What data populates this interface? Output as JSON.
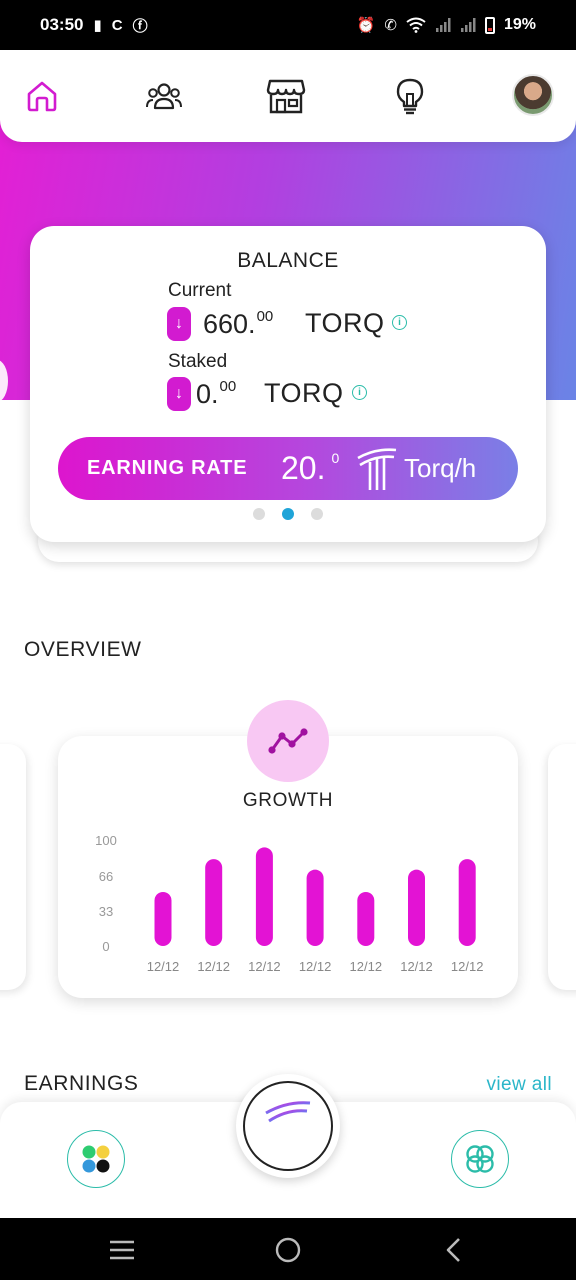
{
  "status_bar": {
    "time": "03:50",
    "battery_percent": "19%",
    "left_icons": [
      "sim-alert-icon",
      "c-icon",
      "facebook-icon"
    ],
    "right_icons": [
      "alarm-icon",
      "wifi-call-icon",
      "wifi-icon",
      "signal-icon",
      "signal-icon",
      "battery-icon"
    ]
  },
  "top_nav": {
    "items": [
      {
        "name": "home",
        "icon": "home-icon",
        "active": true
      },
      {
        "name": "community",
        "icon": "people-icon",
        "active": false
      },
      {
        "name": "store",
        "icon": "store-icon",
        "active": false
      },
      {
        "name": "ideas",
        "icon": "lightbulb-icon",
        "active": false
      },
      {
        "name": "profile",
        "icon": "avatar",
        "active": false
      }
    ]
  },
  "balance": {
    "title": "BALANCE",
    "current_label": "Current",
    "current_amount": "660.",
    "current_decimals": "00",
    "current_unit": "TORQ",
    "staked_label": "Staked",
    "staked_amount": "0.",
    "staked_decimals": "00",
    "staked_unit": "TORQ",
    "arrow_glyph": "↓",
    "info_glyph": "i",
    "earning_rate_label": "EARNING RATE",
    "earning_rate_value": "20.",
    "earning_rate_decimals": "0",
    "earning_rate_unit": "Torq/h",
    "pager": {
      "count": 3,
      "active_index": 1
    }
  },
  "overview": {
    "title": "OVERVIEW",
    "card_title": "GROWTH",
    "card_icon": "trend-line-icon"
  },
  "chart_data": {
    "type": "bar",
    "title": "GROWTH",
    "categories": [
      "12/12",
      "12/12",
      "12/12",
      "12/12",
      "12/12",
      "12/12",
      "12/12"
    ],
    "values": [
      51,
      82,
      93,
      72,
      51,
      72,
      82
    ],
    "y_ticks": [
      "100",
      "66",
      "33",
      "0"
    ],
    "ylim": [
      0,
      100
    ],
    "grid": false,
    "bar_color": "#e313d4"
  },
  "earnings": {
    "title": "EARNINGS",
    "view_all": "view all"
  },
  "bottom_bar": {
    "left_icon": "apps-dots-icon",
    "center_icon": "torq-logo-icon",
    "right_icon": "linked-rings-icon"
  },
  "colors": {
    "accent": "#d21bd0",
    "teal": "#2bbca9",
    "gradient_start": "#e51ed4",
    "gradient_end": "#6a84e6",
    "pager_active": "#1fa4d8"
  }
}
